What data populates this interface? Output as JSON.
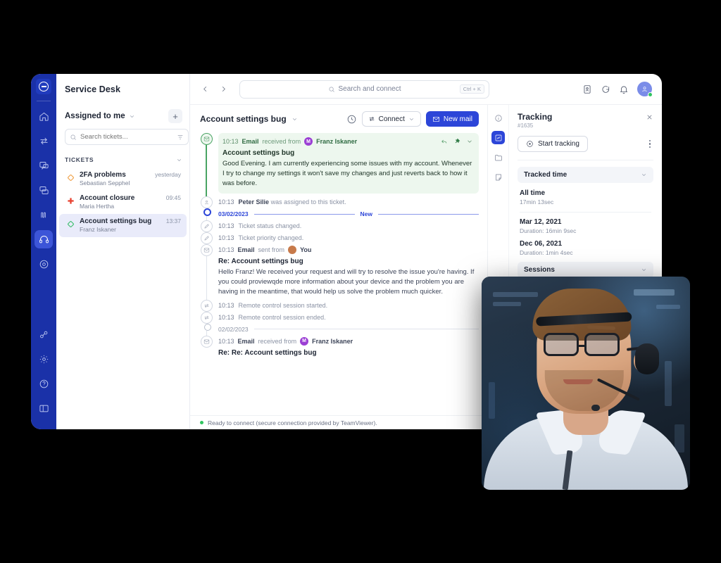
{
  "app": {
    "title": "Service Desk",
    "logo_icon": "teamviewer-logo-icon"
  },
  "nav_rail": {
    "items": [
      {
        "icon": "home-icon",
        "name": "home",
        "active": false
      },
      {
        "icon": "transfer-icon",
        "name": "connections",
        "active": false
      },
      {
        "icon": "chat-icon",
        "name": "chat",
        "active": false
      },
      {
        "icon": "devices-icon",
        "name": "devices",
        "active": false
      },
      {
        "icon": "monitoring-icon",
        "name": "monitoring",
        "active": false
      },
      {
        "icon": "headset-icon",
        "name": "service-desk",
        "active": true
      },
      {
        "icon": "camera-icon",
        "name": "augmented-reality",
        "active": false
      }
    ],
    "bottom_items": [
      {
        "icon": "link-icon",
        "name": "integrations"
      },
      {
        "icon": "gear-icon",
        "name": "settings"
      },
      {
        "icon": "help-icon",
        "name": "help"
      },
      {
        "icon": "panel-icon",
        "name": "layout"
      }
    ]
  },
  "sidebar": {
    "filter_label": "Assigned to me",
    "add_button_label": "+",
    "search_placeholder": "Search tickets...",
    "section_label": "TICKETS",
    "tickets": [
      {
        "priority_icon": "diamond-orange-icon",
        "priority_color": "#f0a24a",
        "title": "2FA problems",
        "time": "yesterday",
        "requester": "Sebastian Sepphel",
        "selected": false
      },
      {
        "priority_icon": "cross-red-icon",
        "priority_color": "#e8412f",
        "title": "Account closure",
        "time": "09:45",
        "requester": "Maria Hertha",
        "selected": false
      },
      {
        "priority_icon": "diamond-green-icon",
        "priority_color": "#3fbf6f",
        "title": "Account settings bug",
        "time": "13:37",
        "requester": "Franz Iskaner",
        "selected": true
      }
    ]
  },
  "topbar": {
    "back_icon": "chevron-left-icon",
    "forward_icon": "chevron-right-icon",
    "search_placeholder": "Search and connect",
    "search_shortcut": "Ctrl + K",
    "icons": [
      {
        "icon": "contact-card-icon",
        "name": "contacts"
      },
      {
        "icon": "chat-bubble-icon",
        "name": "messages"
      },
      {
        "icon": "bell-icon",
        "name": "notifications"
      }
    ],
    "avatar_icon": "user-avatar-icon",
    "status": "online"
  },
  "thread": {
    "title": "Account settings bug",
    "title_chevron": "chevron-down-icon",
    "history_icon": "clock-icon",
    "connect_label": "Connect",
    "connect_icon": "transfer-icon",
    "new_mail_label": "New mail",
    "new_mail_icon": "envelope-icon",
    "accent_color": "#2c45d8",
    "events": [
      {
        "type": "message",
        "highlight": true,
        "icon": "envelope-icon",
        "time": "10:13",
        "kind": "Email",
        "action": "received from",
        "author": "Franz Iskaner",
        "avatar_initial": "M",
        "avatar_color": "#9b3fd4",
        "subject": "Account settings bug",
        "body": "Good Evening. I am currently experiencing some issues with my account. Whenever I try to change my settings it won't save my changes and just reverts back to how it was before.",
        "actions": [
          "reply-icon",
          "pin-icon",
          "chevron-down-icon"
        ]
      },
      {
        "type": "event",
        "icon": "user-assign-icon",
        "time": "10:13",
        "actor": "Peter Silie",
        "text": "was assigned to this ticket."
      },
      {
        "type": "divider",
        "date": "03/02/2023",
        "badge": "New",
        "accent": true
      },
      {
        "type": "event",
        "icon": "pencil-icon",
        "time": "10:13",
        "actor": "",
        "text": "Ticket status changed."
      },
      {
        "type": "event",
        "icon": "pencil-icon",
        "time": "10:13",
        "actor": "",
        "text": "Ticket priority changed."
      },
      {
        "type": "message",
        "highlight": false,
        "icon": "envelope-icon",
        "time": "10:13",
        "kind": "Email",
        "action": "sent from",
        "author": "You",
        "avatar_initial": "",
        "avatar_color": "#c77a4a",
        "subject": "Re: Account settings bug",
        "body": "Hello Franz! We received your request and will try to resolve the issue you're having.  If you could proviewqde more information about your device and the problem you are having in the meantime, that would help us solve the problem much quicker.",
        "actions": []
      },
      {
        "type": "event",
        "icon": "transfer-icon",
        "time": "10:13",
        "actor": "",
        "text": "Remote control session started."
      },
      {
        "type": "event",
        "icon": "transfer-icon",
        "time": "10:13",
        "actor": "",
        "text": "Remote control session ended."
      },
      {
        "type": "divider",
        "date": "02/02/2023",
        "badge": "",
        "accent": false
      },
      {
        "type": "message",
        "highlight": false,
        "icon": "envelope-icon",
        "time": "10:13",
        "kind": "Email",
        "action": "received from",
        "author": "Franz Iskaner",
        "avatar_initial": "M",
        "avatar_color": "#9b3fd4",
        "subject": "Re: Re: Account settings bug",
        "body": "",
        "actions": []
      }
    ]
  },
  "statusbar": {
    "text": "Ready to connect (secure connection provided by TeamViewer).",
    "dot_color": "#30c45f"
  },
  "right_panel": {
    "rail_icons": [
      {
        "icon": "info-icon",
        "name": "details",
        "active": false
      },
      {
        "icon": "tracking-icon",
        "name": "tracking",
        "active": true
      },
      {
        "icon": "folder-icon",
        "name": "files",
        "active": false
      },
      {
        "icon": "note-icon",
        "name": "notes",
        "active": false
      }
    ],
    "title": "Tracking",
    "ticket_id": "#1635",
    "close_icon": "close-icon",
    "start_tracking_label": "Start tracking",
    "start_tracking_icon": "record-icon",
    "more_icon": "kebab-menu-icon",
    "sections": [
      {
        "label": "Tracked time",
        "chevron": "chevron-down-icon"
      },
      {
        "label": "Sessions",
        "chevron": "chevron-down-icon"
      }
    ],
    "all_time_label": "All time",
    "all_time_value": "17min 13sec",
    "entries": [
      {
        "date": "Mar 12, 2021",
        "duration": "Duration: 16min 9sec"
      },
      {
        "date": "Dec 06, 2021",
        "duration": "Duration: 1min 4sec"
      }
    ]
  },
  "video_overlay": {
    "name": "support-agent-video-feed",
    "description": "Support agent wearing headset and glasses"
  }
}
